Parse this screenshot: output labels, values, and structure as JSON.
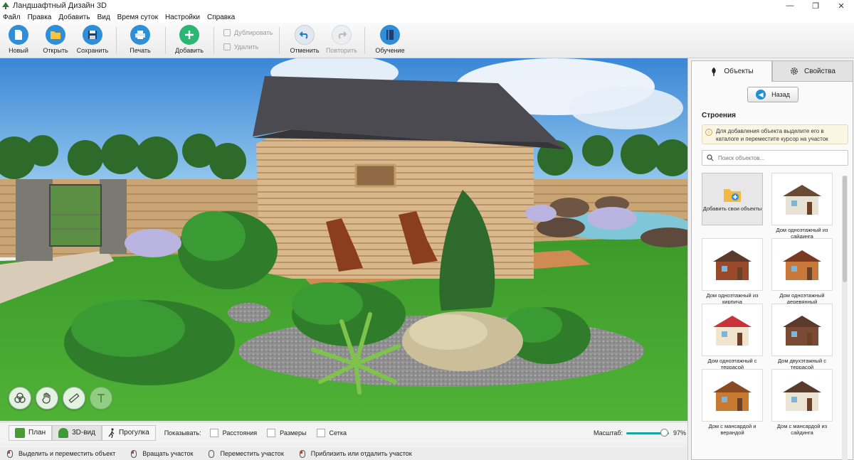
{
  "window": {
    "title": "Ландшафтный Дизайн 3D",
    "controls": [
      "—",
      "❐",
      "✕"
    ]
  },
  "menu": [
    "Файл",
    "Правка",
    "Добавить",
    "Вид",
    "Время суток",
    "Настройки",
    "Справка"
  ],
  "toolbar": {
    "new_label": "Новый",
    "open_label": "Открыть",
    "save_label": "Сохранить",
    "print_label": "Печать",
    "add_label": "Добавить",
    "duplicate_label": "Дублировать",
    "delete_label": "Удалить",
    "undo_label": "Отменить",
    "redo_label": "Повторить",
    "learn_label": "Обучение"
  },
  "viewbar": {
    "plan_label": "План",
    "view3d_label": "3D-вид",
    "walk_label": "Прогулка",
    "show_label": "Показывать:",
    "distances_label": "Расстояния",
    "sizes_label": "Размеры",
    "grid_label": "Сетка",
    "scale_label": "Масштаб:",
    "scale_value": "97%",
    "scale_fraction": 0.97
  },
  "hints": [
    "Выделить и переместить объект",
    "Вращать участок",
    "Переместить участок",
    "Приблизить или отдалить участок"
  ],
  "panel": {
    "tab_objects": "Объекты",
    "tab_properties": "Свойства",
    "back_label": "Назад",
    "section_title": "Строения",
    "info_text": "Для добавления объекта выделите его в каталоге и переместите курсор на участок",
    "search_placeholder": "Поиск объектов...",
    "add_own_label": "Добавить свои объекты",
    "items": [
      {
        "label": "Дом одноэтажный из сайдинга",
        "wall": "#e8e2d4",
        "roof": "#6b4a34"
      },
      {
        "label": "Дом одноэтажный из кирпича",
        "wall": "#9a4a2a",
        "roof": "#5a3a2a"
      },
      {
        "label": "Дом одноэтажный деревянный",
        "wall": "#c9783a",
        "roof": "#7a3a22"
      },
      {
        "label": "Дом одноэтажный с террасой",
        "wall": "#f0e6d0",
        "roof": "#c8323a"
      },
      {
        "label": "Дом двухэтажный с террасой",
        "wall": "#7a4a34",
        "roof": "#5a3a2a"
      },
      {
        "label": "Дом с мансардой и верандой",
        "wall": "#c87a30",
        "roof": "#8a4a22"
      },
      {
        "label": "Дом с мансардой из сайдинга",
        "wall": "#ebe4d2",
        "roof": "#5a3a2a"
      }
    ]
  }
}
